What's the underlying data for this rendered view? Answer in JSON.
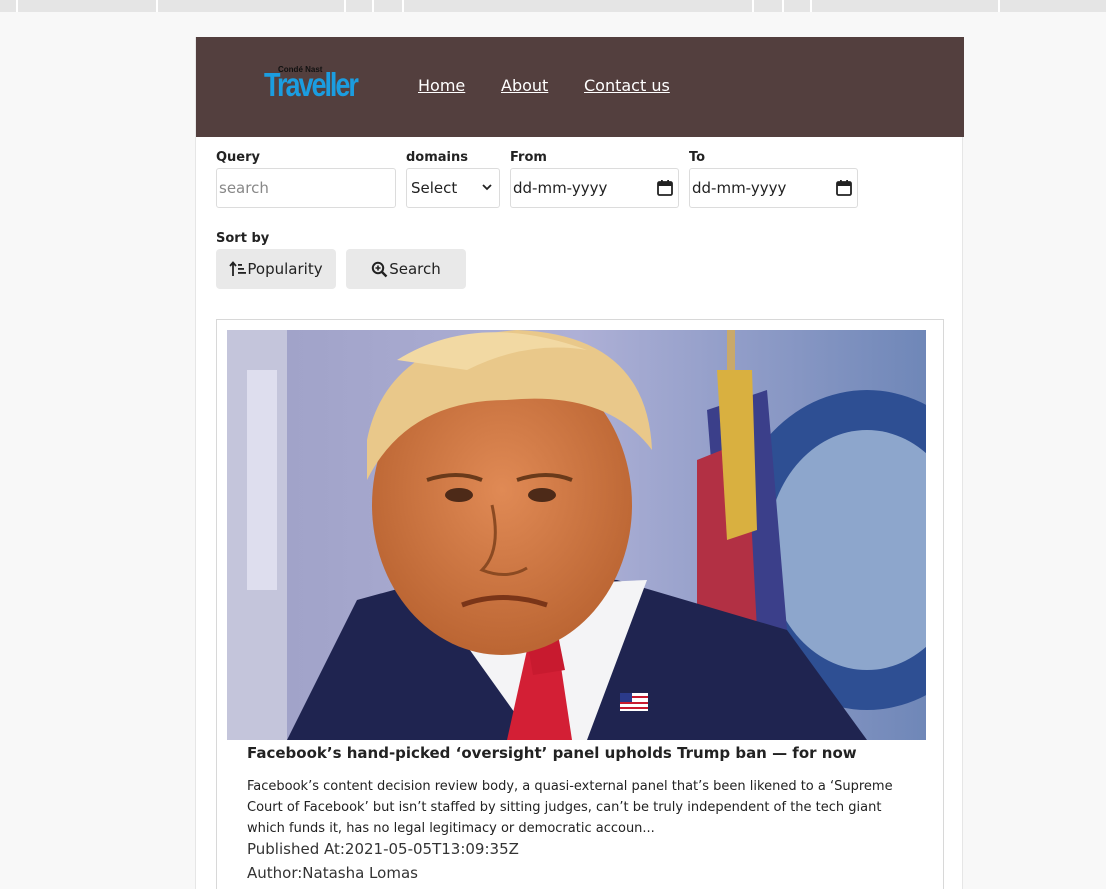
{
  "header": {
    "logo_small": "Condé Nast",
    "logo_text": "Traveller",
    "nav": [
      "Home",
      "About",
      "Contact us"
    ]
  },
  "filters": {
    "query_label": "Query",
    "query_placeholder": "search",
    "domains_label": "domains",
    "domains_value": "Select",
    "from_label": "From",
    "from_value": "dd-mm-yyyy",
    "to_label": "To",
    "to_value": "dd-mm-yyyy",
    "sort_label": "Sort by",
    "sort_button": "Popularity",
    "search_button": "Search"
  },
  "article": {
    "title": "Facebook’s hand-picked ‘oversight’ panel upholds Trump ban — for now",
    "description": "Facebook’s content decision review body, a quasi-external panel that’s been likened to a ‘Supreme Court of Facebook’ but isn’t staffed by sitting judges, can’t be truly independent of the tech giant which funds it, has no legal legitimacy or democratic accoun...",
    "published": "Published At:2021-05-05T13:09:35Z",
    "author": "Author:Natasha Lomas"
  },
  "colors": {
    "header_bg": "#533f3e",
    "logo_blue": "#1b9de0",
    "button_bg": "#e9e9e9"
  }
}
